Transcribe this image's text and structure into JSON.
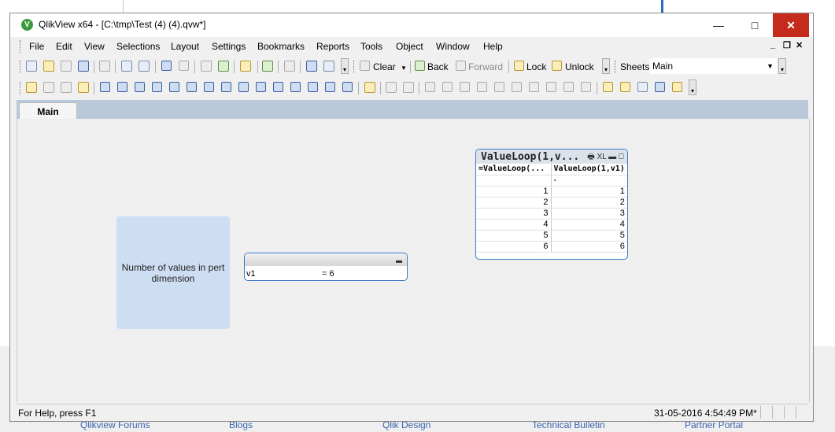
{
  "window": {
    "title": "QlikView x64 - [C:\\tmp\\Test (4) (4).qvw*]",
    "icon_letter": "V"
  },
  "window_controls": {
    "minimize": "—",
    "maximize": "□",
    "close": "✕"
  },
  "menu": {
    "items": [
      "File",
      "Edit",
      "View",
      "Selections",
      "Layout",
      "Settings",
      "Bookmarks",
      "Reports",
      "Tools",
      "Object",
      "Window",
      "Help"
    ]
  },
  "mdi_controls": {
    "minimize": "_",
    "restore": "❐",
    "close": "✕"
  },
  "toolbar1": {
    "clear": "Clear",
    "back": "Back",
    "forward": "Forward",
    "lock": "Lock",
    "unlock": "Unlock",
    "sheets_label": "Sheets",
    "sheets_value": "Main"
  },
  "tabs": [
    {
      "label": "Main",
      "active": true
    }
  ],
  "sheet": {
    "text_object": "Number of values in pert dimension",
    "listbox": {
      "field": "v1",
      "value": "= 6"
    },
    "tablebox": {
      "title": "ValueLoop(1,v...",
      "caption_icons": "🖶 XL ▬ ◻",
      "headers": [
        "=ValueLoop(...",
        "ValueLoop(1,v1)"
      ],
      "dash_row": [
        "",
        "-"
      ],
      "rows": [
        [
          "1",
          "1"
        ],
        [
          "2",
          "2"
        ],
        [
          "3",
          "3"
        ],
        [
          "4",
          "4"
        ],
        [
          "5",
          "5"
        ],
        [
          "6",
          "6"
        ]
      ]
    }
  },
  "status": {
    "help": "For Help, press F1",
    "time": "31-05-2016 4:54:49 PM*"
  },
  "background_links": [
    "Qlikview Forums",
    "Blogs",
    "Qlik Design",
    "Technical Bulletin",
    "Partner Portal"
  ]
}
